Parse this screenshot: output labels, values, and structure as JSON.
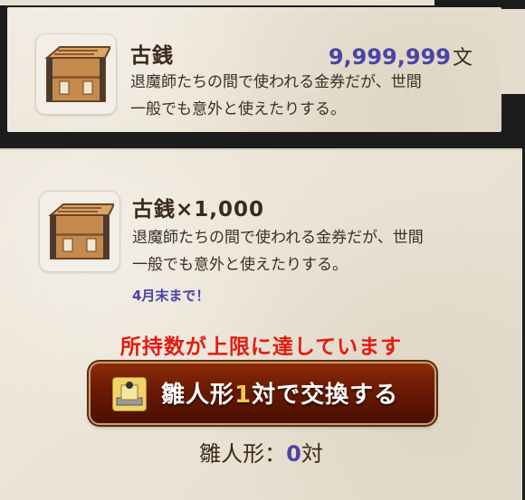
{
  "owned_item": {
    "name": "古銭",
    "count": "9,999,999",
    "unit": "文",
    "description_line1": "退魔師たちの間で使われる金券だが、世間",
    "description_line2": "一般でも意外と使えたりする。",
    "icon": "crate-icon"
  },
  "exchange_item": {
    "name": "古銭×1,000",
    "description_line1": "退魔師たちの間で使われる金券だが、世間",
    "description_line2": "一般でも意外と使えたりする。",
    "deadline": "4月末まで！",
    "icon": "crate-icon"
  },
  "warning": "所持数が上限に達しています",
  "exchange_button": {
    "label_prefix": "雛人形",
    "label_count": "1",
    "label_suffix": "対で交換する",
    "icon": "hina-doll-icon"
  },
  "hina_count": {
    "label": "雛人形：",
    "value": "0",
    "unit": "対"
  },
  "colors": {
    "accent_blue": "#4a44a8",
    "warning_red": "#e31b12",
    "button_brown": "#6a1a03",
    "button_number": "#f5c84a"
  }
}
